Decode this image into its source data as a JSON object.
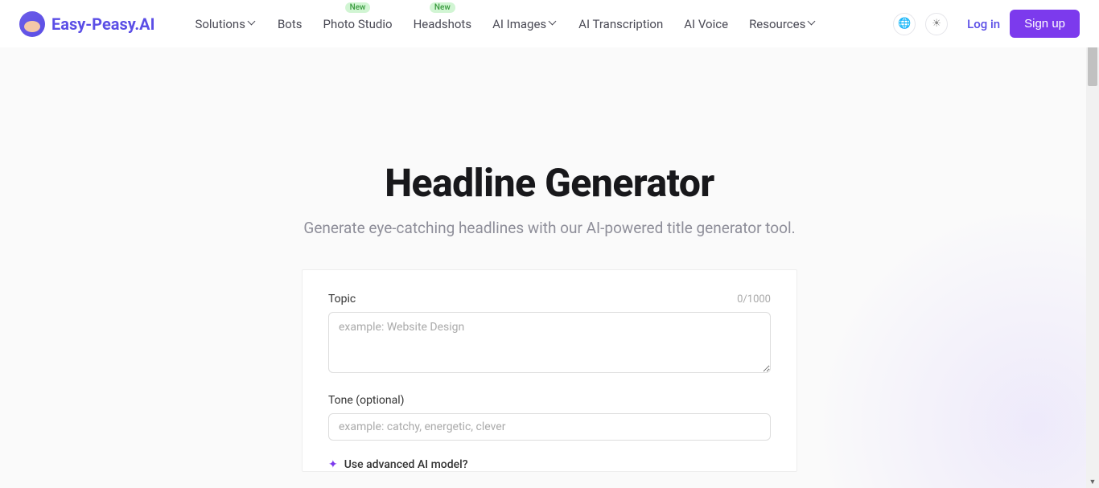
{
  "brand": "Easy-Peasy.AI",
  "nav": {
    "items": [
      {
        "label": "Solutions",
        "dropdown": true,
        "badge": null
      },
      {
        "label": "Bots",
        "dropdown": false,
        "badge": null
      },
      {
        "label": "Photo Studio",
        "dropdown": false,
        "badge": "New"
      },
      {
        "label": "Headshots",
        "dropdown": false,
        "badge": "New"
      },
      {
        "label": "AI Images",
        "dropdown": true,
        "badge": null
      },
      {
        "label": "AI Transcription",
        "dropdown": false,
        "badge": null
      },
      {
        "label": "AI Voice",
        "dropdown": false,
        "badge": null
      },
      {
        "label": "Resources",
        "dropdown": true,
        "badge": null
      }
    ]
  },
  "auth": {
    "login": "Log in",
    "signup": "Sign up"
  },
  "page": {
    "title": "Headline Generator",
    "subtitle": "Generate eye-catching headlines with our AI-powered title generator tool."
  },
  "form": {
    "topic": {
      "label": "Topic",
      "placeholder": "example: Website Design",
      "counter": "0/1000"
    },
    "tone": {
      "label": "Tone (optional)",
      "placeholder": "example: catchy, energetic, clever"
    },
    "advanced": {
      "label": "Use advanced AI model?"
    }
  }
}
